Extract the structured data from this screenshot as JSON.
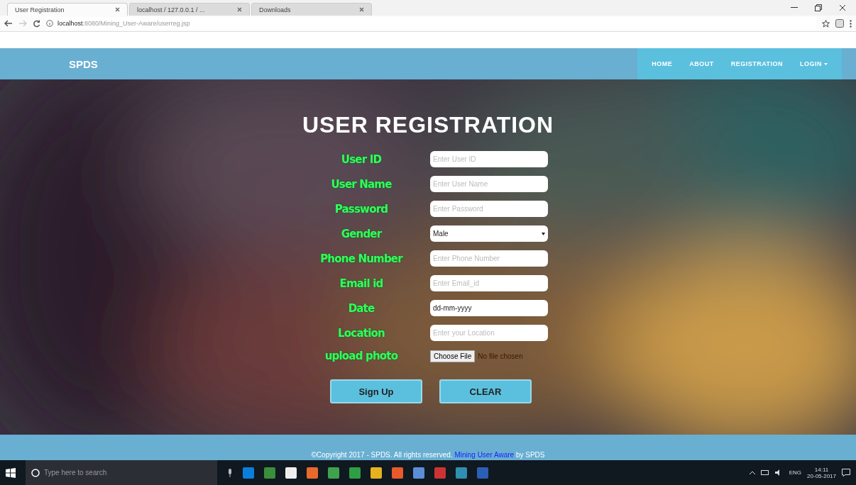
{
  "browser": {
    "tabs": [
      {
        "label": "User Registration",
        "selected": true
      },
      {
        "label": "localhost / 127.0.0.1 / ...",
        "selected": false
      },
      {
        "label": "Downloads",
        "selected": false
      }
    ],
    "address": {
      "host": "localhost",
      "path": ":8080/Mining_User-Aware/userreg.jsp"
    }
  },
  "navbar": {
    "brand": "SPDS",
    "items": [
      {
        "label": "HOME",
        "dropdown": false
      },
      {
        "label": "ABOUT",
        "dropdown": false
      },
      {
        "label": "REGISTRATION",
        "dropdown": false
      },
      {
        "label": "LOGIN",
        "dropdown": true
      }
    ]
  },
  "form": {
    "title": "USER REGISTRATION",
    "fields": [
      {
        "kind": "input",
        "label": "User ID",
        "placeholder": "Enter User ID"
      },
      {
        "kind": "input",
        "label": "User Name",
        "placeholder": "Enter User Name"
      },
      {
        "kind": "input",
        "label": "Password",
        "placeholder": "Enter Password"
      },
      {
        "kind": "select",
        "label": "Gender",
        "value": "Male"
      },
      {
        "kind": "input",
        "label": "Phone Number",
        "placeholder": "Enter Phone Number"
      },
      {
        "kind": "input",
        "label": "Email id",
        "placeholder": "Enter Email_id"
      },
      {
        "kind": "date",
        "label": "Date",
        "value": "dd-mm-yyyy"
      },
      {
        "kind": "input",
        "label": "Location",
        "placeholder": "Enter your Location"
      },
      {
        "kind": "file",
        "label": "upload photo",
        "button": "Choose File",
        "status": "No file chosen"
      }
    ],
    "buttons": [
      "Sign Up",
      "CLEAR"
    ]
  },
  "footer": {
    "text": "©Copyright 2017 - SPDS. All rights reserved.",
    "link": "Mining User Aware",
    "suffix": "by SPDS"
  },
  "taskbar": {
    "search_placeholder": "Type here to search",
    "language": "ENG",
    "time": "14:11",
    "date": "20-05-2017"
  }
}
